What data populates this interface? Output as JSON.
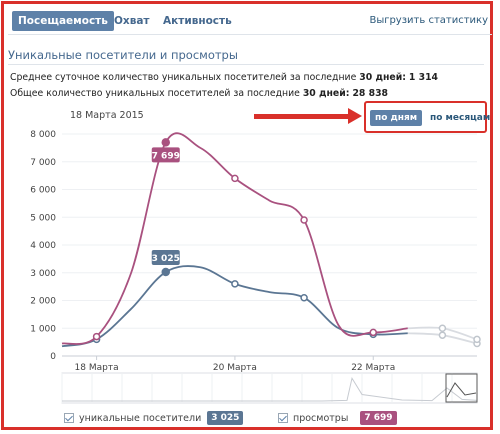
{
  "tabs": [
    {
      "label": "Посещаемость",
      "active": true
    },
    {
      "label": "Охват",
      "active": false
    },
    {
      "label": "Активность",
      "active": false
    }
  ],
  "export_link": "Выгрузить статистику",
  "section_title": "Уникальные посетители и просмотры",
  "stats": {
    "avg_prefix": "Среднее суточное количество уникальных посетителей за последние",
    "avg_days": "30 дней:",
    "avg_value": "1 314",
    "total_prefix": "Общее количество уникальных посетителей за последние",
    "total_days": "30 дней:",
    "total_value": "28 838"
  },
  "current_date": "18 Марта 2015",
  "period": {
    "days": "по дням",
    "months": "по месяцам",
    "selected": "days"
  },
  "legend": {
    "visitors_label": "уникальные посетители",
    "visitors_value": "3 025",
    "views_label": "просмотры",
    "views_value": "7 699"
  },
  "colors": {
    "visitors": "#5b7693",
    "views": "#a9517f",
    "accent": "#5e81a8",
    "highlight": "#d9302a"
  },
  "chart_data": {
    "type": "line",
    "ylim": [
      0,
      8000
    ],
    "yticks": [
      0,
      1000,
      2000,
      3000,
      4000,
      5000,
      6000,
      7000,
      8000
    ],
    "ytick_labels": [
      "0",
      "1 000",
      "2 000",
      "3 000",
      "4 000",
      "5 000",
      "6 000",
      "7 000",
      "8 000"
    ],
    "x": [
      0,
      1,
      2,
      3,
      4,
      5,
      6,
      7,
      8,
      9,
      10,
      11,
      12
    ],
    "xtick_labels": [
      {
        "x": 1,
        "label": "18 Марта"
      },
      {
        "x": 5,
        "label": "20 Марта"
      },
      {
        "x": 9,
        "label": "22 Марта"
      }
    ],
    "series": [
      {
        "name": "уникальные посетители",
        "values": [
          350,
          600,
          1700,
          3025,
          3200,
          2600,
          2300,
          2100,
          1000,
          780,
          820,
          750,
          450
        ]
      },
      {
        "name": "просмотры",
        "values": [
          450,
          700,
          3000,
          7699,
          7500,
          6400,
          5600,
          4900,
          1100,
          850,
          1000,
          1000,
          600
        ]
      }
    ],
    "point_markers": [
      1,
      3,
      5,
      7,
      9,
      11
    ],
    "highlighted_index": 3,
    "highlighted_labels": {
      "visitors": "3 025",
      "views": "7 699"
    },
    "faded_from_index": 10
  }
}
